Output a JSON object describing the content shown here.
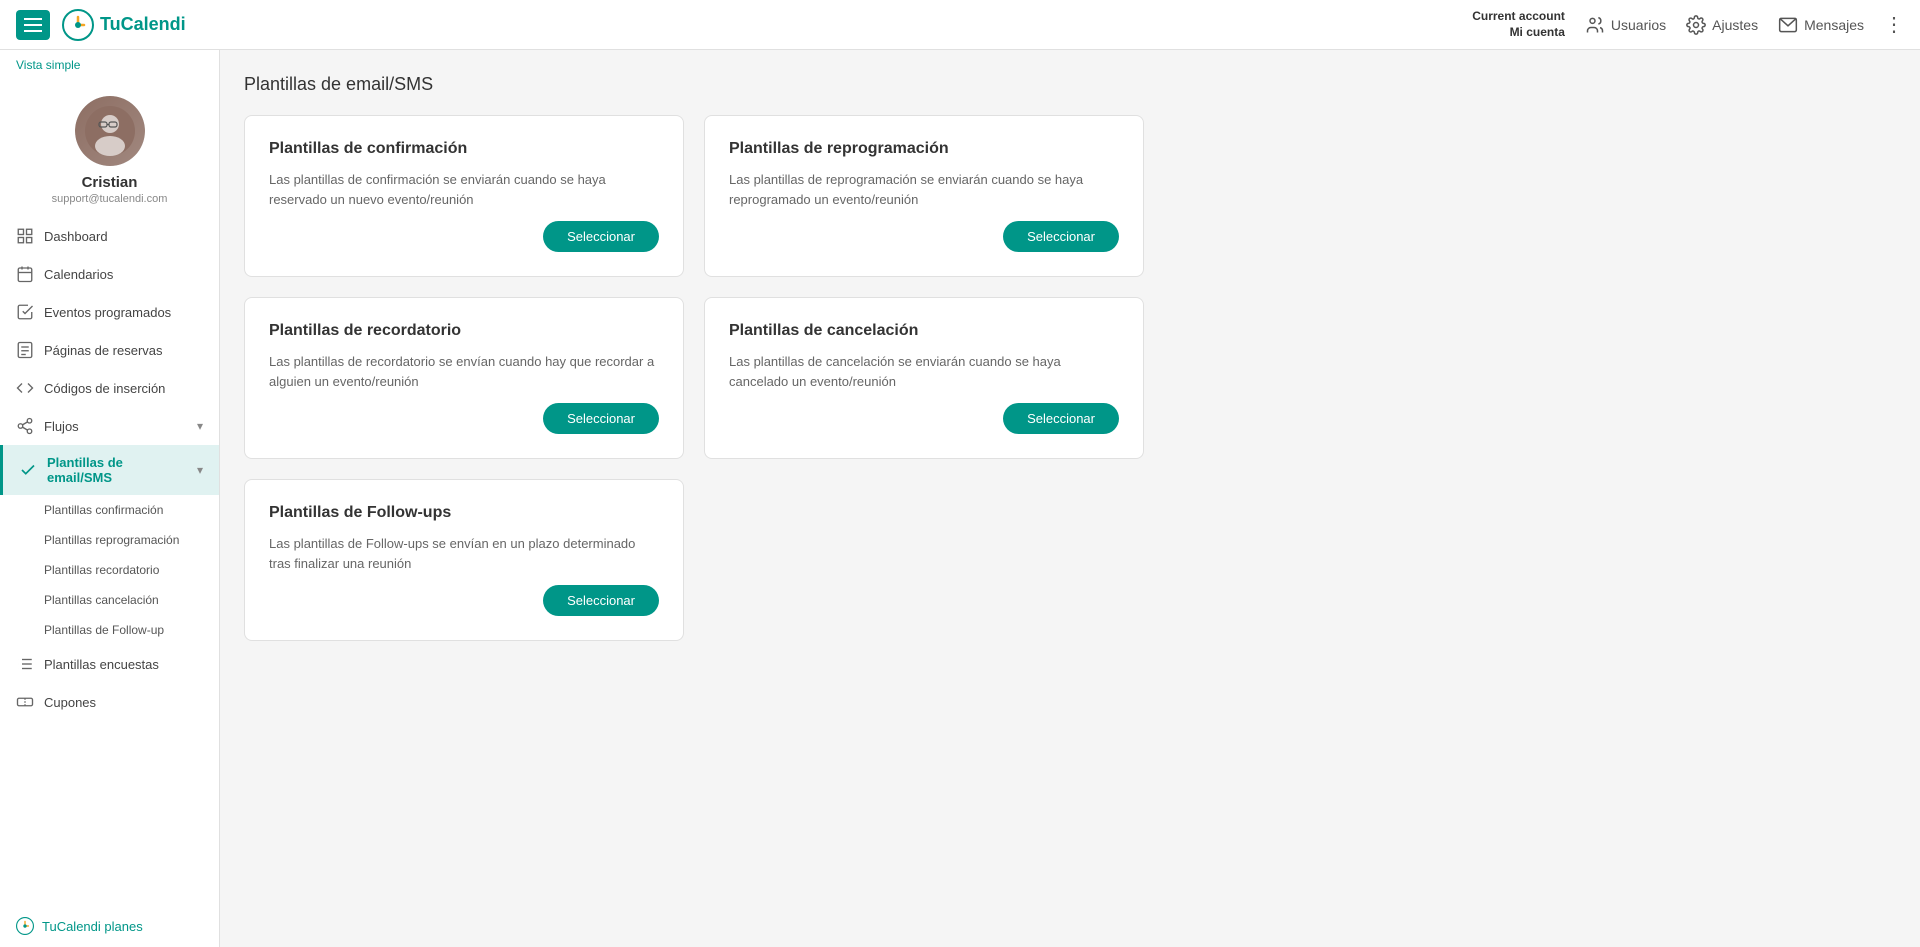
{
  "topnav": {
    "logo_text": "TuCalendi",
    "current_account_label": "Current account",
    "mi_cuenta": "Mi cuenta",
    "usuarios_label": "Usuarios",
    "ajustes_label": "Ajustes",
    "mensajes_label": "Mensajes"
  },
  "sidebar": {
    "vista_simple": "Vista simple",
    "profile": {
      "name": "Cristian",
      "email": "support@tucalendi.com"
    },
    "nav": [
      {
        "id": "dashboard",
        "label": "Dashboard",
        "icon": "grid"
      },
      {
        "id": "calendarios",
        "label": "Calendarios",
        "icon": "calendar"
      },
      {
        "id": "eventos",
        "label": "Eventos programados",
        "icon": "check-square"
      },
      {
        "id": "paginas",
        "label": "Páginas de reservas",
        "icon": "file"
      },
      {
        "id": "codigos",
        "label": "Códigos de inserción",
        "icon": "code"
      },
      {
        "id": "flujos",
        "label": "Flujos",
        "icon": "git-branch",
        "hasChevron": true
      },
      {
        "id": "plantillas-email",
        "label": "Plantillas de email/SMS",
        "icon": "check",
        "active": true,
        "hasChevron": true
      }
    ],
    "submenu": [
      {
        "id": "plantillas-confirmacion",
        "label": "Plantillas confirmación"
      },
      {
        "id": "plantillas-reprogramacion",
        "label": "Plantillas reprogramación"
      },
      {
        "id": "plantillas-recordatorio",
        "label": "Plantillas recordatorio"
      },
      {
        "id": "plantillas-cancelacion",
        "label": "Plantillas cancelación"
      },
      {
        "id": "plantillas-followup",
        "label": "Plantillas de Follow-up"
      }
    ],
    "plantillas_encuestas": "Plantillas encuestas",
    "cupones": "Cupones",
    "tucalendi_planes": "TuCalendi planes"
  },
  "main": {
    "page_title": "Plantillas de email/SMS",
    "cards": [
      {
        "id": "confirmacion",
        "title": "Plantillas de confirmación",
        "description": "Las plantillas de confirmación se enviarán cuando se haya reservado un nuevo evento/reunión",
        "btn_label": "Seleccionar"
      },
      {
        "id": "reprogramacion",
        "title": "Plantillas de reprogramación",
        "description": "Las plantillas de reprogramación se enviarán cuando se haya reprogramado un evento/reunión",
        "btn_label": "Seleccionar"
      },
      {
        "id": "recordatorio",
        "title": "Plantillas de recordatorio",
        "description": "Las plantillas de recordatorio se envían cuando hay que recordar a alguien un evento/reunión",
        "btn_label": "Seleccionar"
      },
      {
        "id": "cancelacion",
        "title": "Plantillas de cancelación",
        "description": "Las plantillas de cancelación se enviarán cuando se haya cancelado un evento/reunión",
        "btn_label": "Seleccionar"
      },
      {
        "id": "followups",
        "title": "Plantillas de Follow-ups",
        "description": "Las plantillas de Follow-ups se envían en un plazo determinado tras finalizar una reunión",
        "btn_label": "Seleccionar",
        "single": true
      }
    ]
  }
}
